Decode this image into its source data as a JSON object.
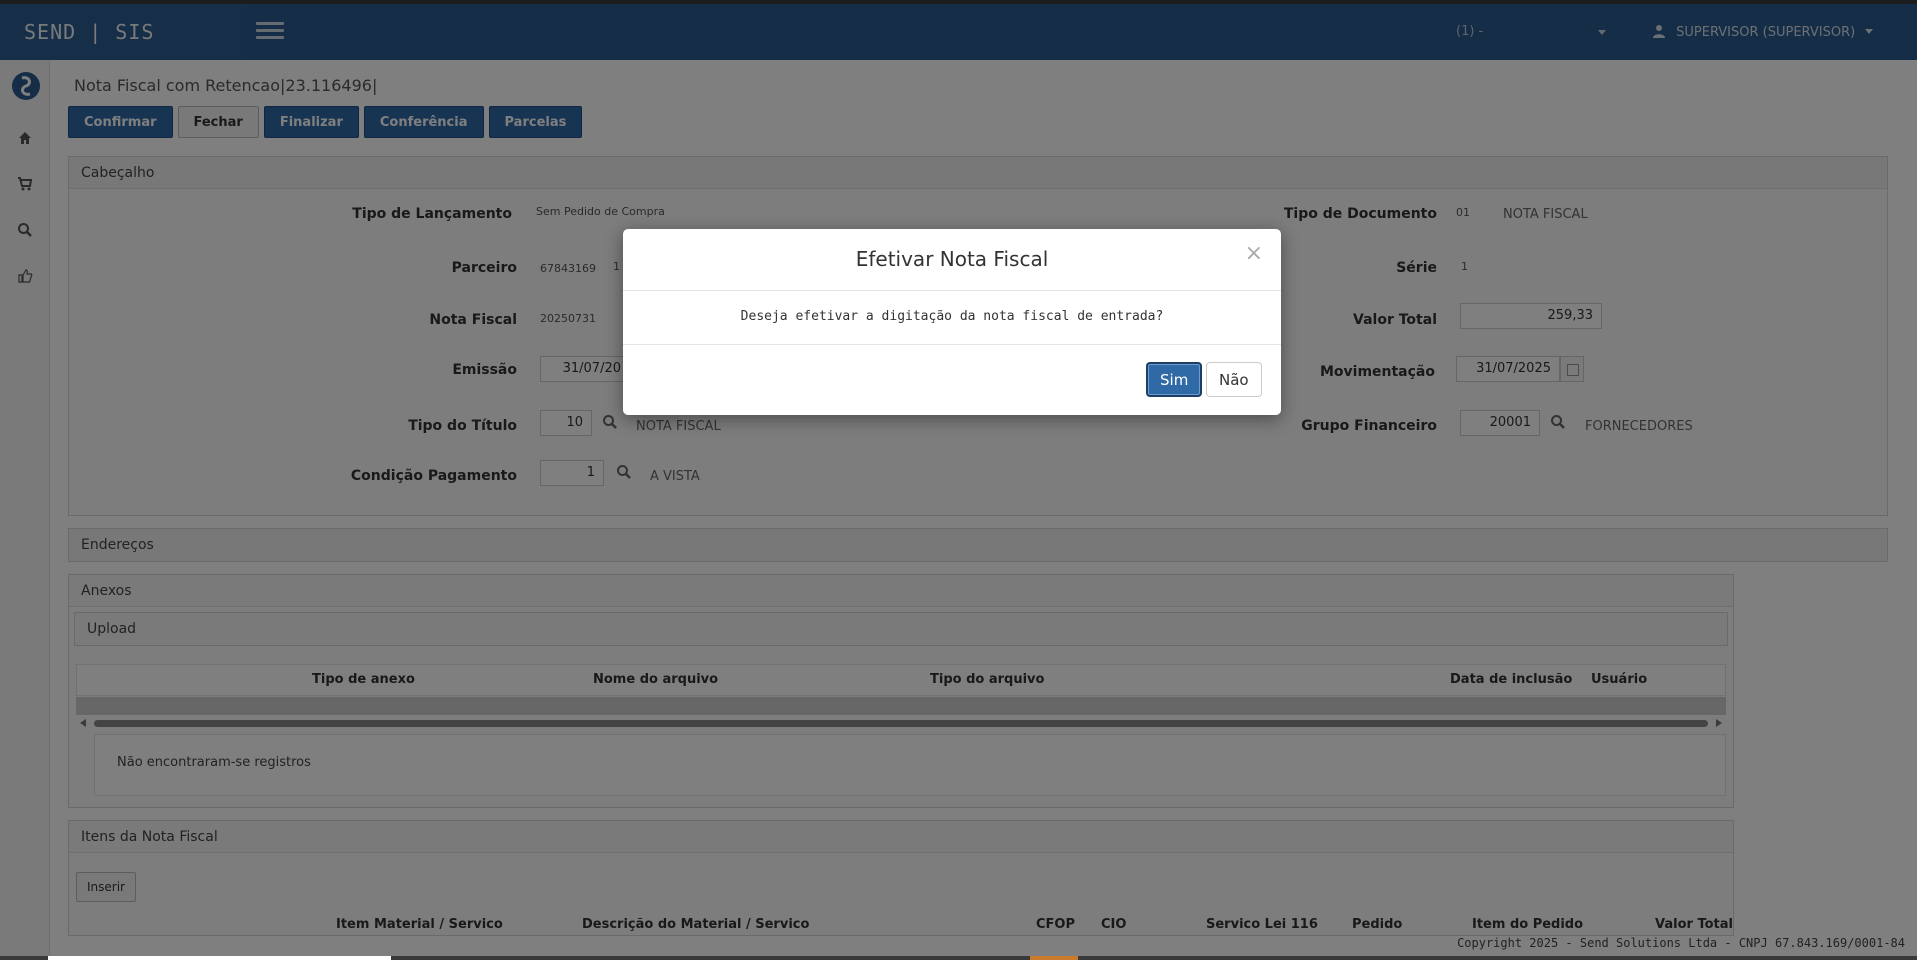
{
  "header": {
    "brand": "SEND | SIS",
    "company": "(1) -",
    "user": "SUPERVISOR (SUPERVISOR)"
  },
  "page": {
    "title": "Nota Fiscal com Retencao|23.116496|"
  },
  "toolbar": {
    "confirm": "Confirmar",
    "close": "Fechar",
    "finalize": "Finalizar",
    "check": "Conferência",
    "installments": "Parcelas"
  },
  "cabecalho": {
    "title": "Cabeçalho",
    "tipo_lancamento_label": "Tipo de Lançamento",
    "tipo_lancamento_value": "Sem Pedido de Compra",
    "parceiro_label": "Parceiro",
    "parceiro_code": "67843169",
    "parceiro_extra": "1",
    "nota_fiscal_label": "Nota Fiscal",
    "nota_fiscal_value": "20250731",
    "emissao_label": "Emissão",
    "emissao_value": "31/07/20",
    "tipo_titulo_label": "Tipo do Título",
    "tipo_titulo_code": "10",
    "tipo_titulo_desc": "NOTA FISCAL",
    "condicao_label": "Condição Pagamento",
    "condicao_code": "1",
    "condicao_desc": "A VISTA",
    "tipo_documento_label": "Tipo de Documento",
    "tipo_documento_code": "01",
    "tipo_documento_desc": "NOTA FISCAL",
    "serie_label": "Série",
    "serie_value": "1",
    "valor_total_label": "Valor Total",
    "valor_total_value": "259,33",
    "movimentacao_label": "Movimentação",
    "movimentacao_value": "31/07/2025",
    "grupo_label": "Grupo Financeiro",
    "grupo_code": "20001",
    "grupo_desc": "FORNECEDORES"
  },
  "enderecos": {
    "title": "Endereços"
  },
  "anexos": {
    "title": "Anexos",
    "upload": "Upload",
    "columns": [
      "Tipo de anexo",
      "Nome do arquivo",
      "Tipo do arquivo",
      "Data de inclusão",
      "Usuário"
    ],
    "empty": "Não encontraram-se registros"
  },
  "itens": {
    "title": "Itens da Nota Fiscal",
    "insert": "Inserir",
    "columns": [
      "Item",
      "Material / Servico",
      "Descrição do Material / Servico",
      "CFOP",
      "CIO",
      "Servico Lei 116",
      "Pedido",
      "Item do Pedido",
      "Valor Total"
    ]
  },
  "footer": {
    "copyright": "Copyright 2025 - Send Solutions Ltda - CNPJ 67.843.169/0001-84"
  },
  "modal": {
    "title": "Efetivar Nota Fiscal",
    "close": "×",
    "message": "Deseja efetivar a digitação da nota fiscal de entrada?",
    "yes": "Sim",
    "no": "Não"
  }
}
